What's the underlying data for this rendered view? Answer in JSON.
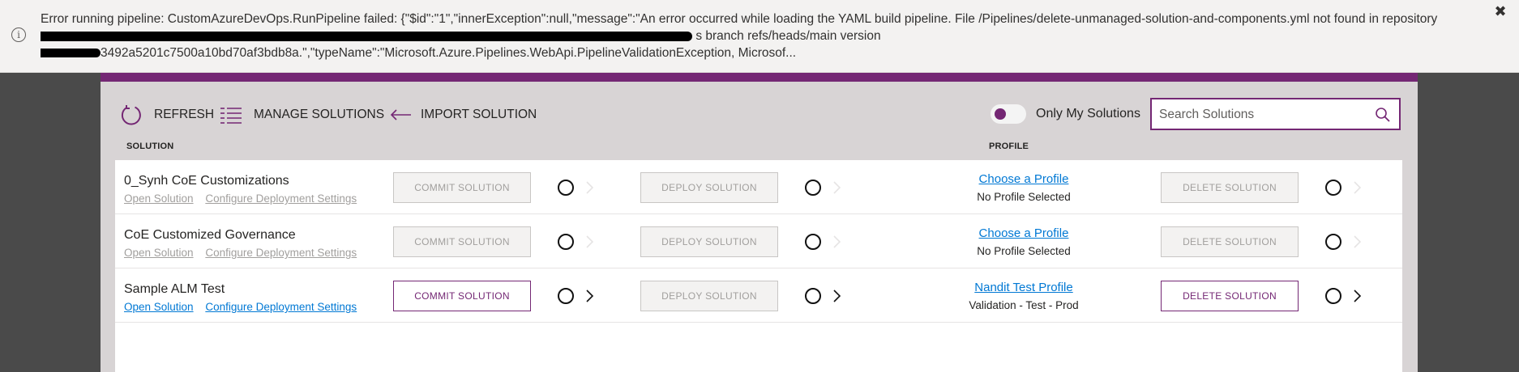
{
  "banner": {
    "line1": "Error running pipeline: CustomAzureDevOps.RunPipeline failed: {\"$id\":\"1\",\"innerException\":null,\"message\":\"An error occurred while loading the YAML build pipeline. File /Pipelines/delete-unmanaged-solution-and-components.yml not found in repository",
    "line2_visible": "s branch refs/heads/main version",
    "line3_visible": "3492a5201c7500a10bd70af3bdb8a.\",\"typeName\":\"Microsoft.Azure.Pipelines.WebApi.PipelineValidationException, Microsof...",
    "close_glyph": "✖"
  },
  "toolbar": {
    "refresh_label": "REFRESH",
    "manage_label": "MANAGE SOLUTIONS",
    "import_label": "IMPORT SOLUTION",
    "toggle_label": "Only My Solutions",
    "search_placeholder": "Search Solutions"
  },
  "columns": {
    "solution": "SOLUTION",
    "profile": "PROFILE"
  },
  "rows": [
    {
      "name": "0_Synh CoE Customizations",
      "open_link": "Open Solution",
      "config_link": "Configure Deployment Settings",
      "commit_label": "COMMIT SOLUTION",
      "deploy_label": "DEPLOY SOLUTION",
      "profile_link": "Choose a Profile",
      "profile_desc": "No Profile Selected",
      "delete_label": "DELETE SOLUTION",
      "enabled": false
    },
    {
      "name": "CoE Customized Governance",
      "open_link": "Open Solution",
      "config_link": "Configure Deployment Settings",
      "commit_label": "COMMIT SOLUTION",
      "deploy_label": "DEPLOY SOLUTION",
      "profile_link": "Choose a Profile",
      "profile_desc": "No Profile Selected",
      "delete_label": "DELETE SOLUTION",
      "enabled": false
    },
    {
      "name": "Sample ALM Test",
      "open_link": "Open Solution",
      "config_link": "Configure Deployment Settings",
      "commit_label": "COMMIT SOLUTION",
      "deploy_label": "DEPLOY SOLUTION",
      "profile_link": "Nandit Test Profile",
      "profile_desc": "Validation - Test - Prod",
      "delete_label": "DELETE SOLUTION",
      "enabled": true
    }
  ],
  "colors": {
    "accent": "#742774",
    "link": "#0078d4",
    "disabled_text": "#a19f9d"
  }
}
